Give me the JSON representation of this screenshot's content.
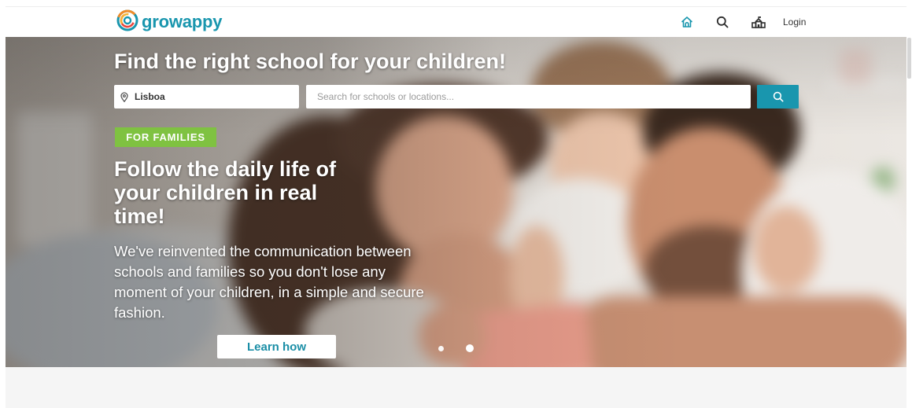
{
  "header": {
    "logo": {
      "text": "growappy",
      "icon": "growappy-logo-icon"
    },
    "nav": {
      "home_icon": "home-icon",
      "search_icon": "search-icon",
      "schools_icon": "school-icon",
      "login_label": "Login"
    }
  },
  "hero": {
    "title": "Find the right school for your children!",
    "search": {
      "location_icon": "map-pin-icon",
      "location_value": "Lisboa",
      "query_placeholder": "Search for schools or locations...",
      "button_icon": "search-icon"
    },
    "badge": "FOR FAMILIES",
    "headline": "Follow the daily life of your children in real time!",
    "description": "We've reinvented the communication between schools and families so you don't lose any moment of your children, in a simple and secure fashion.",
    "cta_label": "Learn how",
    "carousel": {
      "slide_count": 2,
      "active_slide": 2
    }
  },
  "colors": {
    "brand_teal": "#1996ae",
    "badge_green": "#7fc241",
    "logo_orange": "#f28c28",
    "logo_red": "#e8453c"
  }
}
